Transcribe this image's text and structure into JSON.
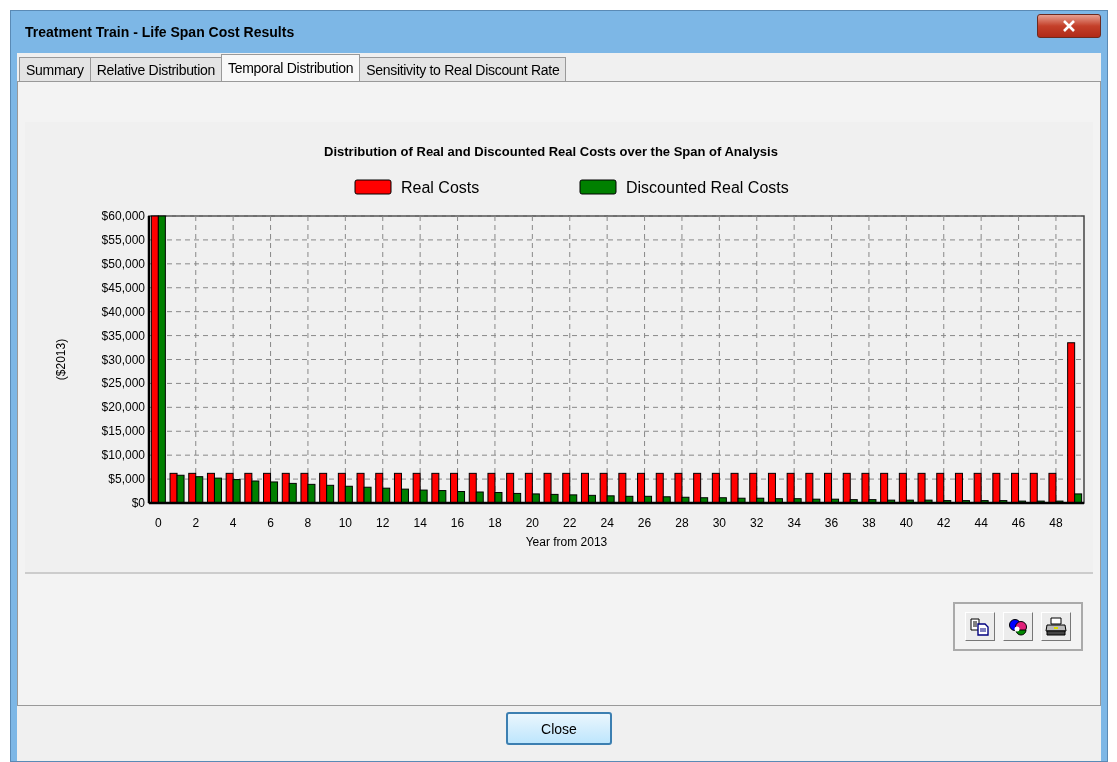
{
  "window": {
    "title": "Treatment Train - Life Span Cost Results"
  },
  "tabs": [
    {
      "label": "Summary",
      "selected": false
    },
    {
      "label": "Relative Distribution",
      "selected": false
    },
    {
      "label": "Temporal Distribution",
      "selected": true
    },
    {
      "label": "Sensitivity to Real Discount Rate",
      "selected": false
    }
  ],
  "chart": {
    "chart_data": {
      "type": "bar",
      "title": "Distribution of Real and Discounted Real Costs over the Span of Analysis",
      "xlabel": "Year from 2013",
      "ylabel": "($2013)",
      "x": [
        0,
        1,
        2,
        3,
        4,
        5,
        6,
        7,
        8,
        9,
        10,
        11,
        12,
        13,
        14,
        15,
        16,
        17,
        18,
        19,
        20,
        21,
        22,
        23,
        24,
        25,
        26,
        27,
        28,
        29,
        30,
        31,
        32,
        33,
        34,
        35,
        36,
        37,
        38,
        39,
        40,
        41,
        42,
        43,
        44,
        45,
        46,
        47,
        48,
        49
      ],
      "grid": true,
      "legend": true,
      "stacked": false,
      "xlim": [
        -0.5,
        49.5
      ],
      "series": [
        {
          "name": "Real Costs",
          "color": "#ff0000",
          "values": [
            60000,
            6200,
            6200,
            6200,
            6200,
            6200,
            6200,
            6200,
            6200,
            6200,
            6200,
            6200,
            6200,
            6200,
            6200,
            6200,
            6200,
            6200,
            6200,
            6200,
            6200,
            6200,
            6200,
            6200,
            6200,
            6200,
            6200,
            6200,
            6200,
            6200,
            6200,
            6200,
            6200,
            6200,
            6200,
            6200,
            6200,
            6200,
            6200,
            6200,
            6200,
            6200,
            6200,
            6200,
            6200,
            6200,
            6200,
            6200,
            6200,
            33500
          ]
        },
        {
          "name": "Discounted Real Costs",
          "color": "#008000",
          "values": [
            60000,
            5800,
            5500,
            5200,
            4900,
            4600,
            4400,
            4100,
            3900,
            3700,
            3500,
            3300,
            3100,
            2900,
            2700,
            2600,
            2400,
            2300,
            2200,
            2000,
            1900,
            1800,
            1700,
            1600,
            1500,
            1400,
            1400,
            1300,
            1200,
            1100,
            1100,
            1000,
            1000,
            900,
            900,
            800,
            800,
            700,
            700,
            600,
            600,
            600,
            500,
            500,
            500,
            500,
            400,
            400,
            400,
            1900
          ]
        }
      ],
      "ylim": [
        0,
        60000
      ],
      "xticks": [
        0,
        2,
        4,
        6,
        8,
        10,
        12,
        14,
        16,
        18,
        20,
        22,
        24,
        26,
        28,
        30,
        32,
        34,
        36,
        38,
        40,
        42,
        44,
        46,
        48
      ],
      "yticks": [
        {
          "value": 0,
          "label": "$0"
        },
        {
          "value": 5000,
          "label": "$5,000"
        },
        {
          "value": 10000,
          "label": "$10,000"
        },
        {
          "value": 15000,
          "label": "$15,000"
        },
        {
          "value": 20000,
          "label": "$20,000"
        },
        {
          "value": 25000,
          "label": "$25,000"
        },
        {
          "value": 30000,
          "label": "$30,000"
        },
        {
          "value": 35000,
          "label": "$35,000"
        },
        {
          "value": 40000,
          "label": "$40,000"
        },
        {
          "value": 45000,
          "label": "$45,000"
        },
        {
          "value": 50000,
          "label": "$50,000"
        },
        {
          "value": 55000,
          "label": "$55,000"
        },
        {
          "value": 60000,
          "label": "$60,000"
        }
      ]
    }
  },
  "toolbar": [
    {
      "kind": "copy"
    },
    {
      "kind": "palette"
    },
    {
      "kind": "print"
    }
  ],
  "buttons": [
    {
      "label": "Close"
    }
  ]
}
